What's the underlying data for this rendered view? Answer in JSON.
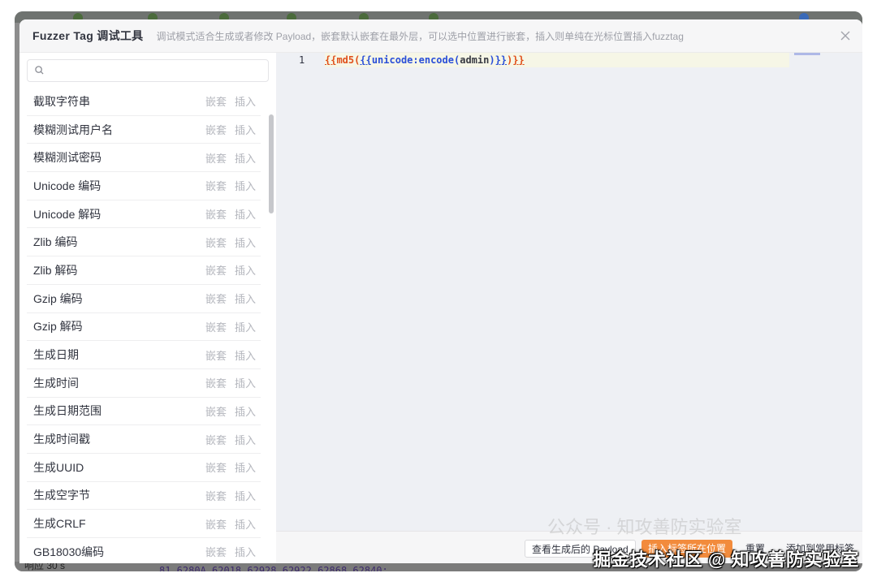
{
  "modal": {
    "title": "Fuzzer Tag 调试工具",
    "subtitle": "调试模式适合生成或者修改 Payload，嵌套默认嵌套在最外层，可以选中位置进行嵌套，插入则单纯在光标位置插入fuzztag",
    "close_icon": "close-icon"
  },
  "search": {
    "placeholder": "",
    "value": "",
    "icon": "search-icon"
  },
  "tags": [
    {
      "name": "截取字符串"
    },
    {
      "name": "模糊测试用户名"
    },
    {
      "name": "模糊测试密码"
    },
    {
      "name": "Unicode 编码"
    },
    {
      "name": "Unicode 解码"
    },
    {
      "name": "Zlib 编码"
    },
    {
      "name": "Zlib 解码"
    },
    {
      "name": "Gzip 编码"
    },
    {
      "name": "Gzip 解码"
    },
    {
      "name": "生成日期"
    },
    {
      "name": "生成时间"
    },
    {
      "name": "生成日期范围"
    },
    {
      "name": "生成时间戳"
    },
    {
      "name": "生成UUID"
    },
    {
      "name": "生成空字节"
    },
    {
      "name": "生成CRLF"
    },
    {
      "name": "GB18030编码"
    }
  ],
  "tag_actions": {
    "nest_label": "嵌套",
    "insert_label": "插入"
  },
  "editor": {
    "line_number": "1",
    "code_tokens": [
      {
        "text": "{{",
        "kind": "brace-outer"
      },
      {
        "text": "md5",
        "kind": "fn-outer"
      },
      {
        "text": "(",
        "kind": "paren-outer"
      },
      {
        "text": "{{",
        "kind": "brace-inner"
      },
      {
        "text": "unicode:encode",
        "kind": "fn-inner"
      },
      {
        "text": "(",
        "kind": "paren-inner"
      },
      {
        "text": "admin",
        "kind": "arg"
      },
      {
        "text": ")",
        "kind": "paren-inner"
      },
      {
        "text": "}}",
        "kind": "brace-inner"
      },
      {
        "text": ")",
        "kind": "paren-outer"
      },
      {
        "text": "}}",
        "kind": "brace-outer"
      }
    ]
  },
  "footer": {
    "view_payload_label": "查看生成后的 Payload",
    "insert_label": "插入标签所在位置",
    "reset_label": "重置",
    "add_common_tag_label": "添加到常用标签"
  },
  "watermark": {
    "text": "掘金技术社区 @ 知攻善防实验室",
    "faint": "公众号 · 知攻善防实验室"
  },
  "background": {
    "timeout_text": "响应  30 s",
    "code_text": "81,6280A,62018,62928,62922,62868,62840;"
  },
  "colors": {
    "accent": "#f28b3c",
    "editor_bg": "#eef0f4",
    "outer_tag": "#e0501a",
    "inner_tag": "#2a4fd8"
  }
}
